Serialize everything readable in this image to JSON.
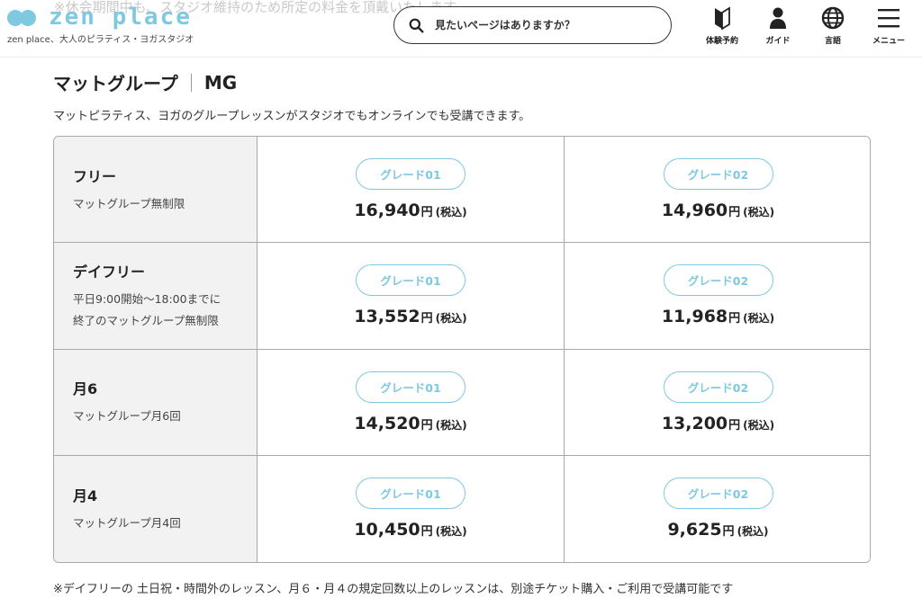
{
  "notice": "※休会期間中も、スタジオ維持のため所定の料金を頂戴いたします",
  "brand": {
    "logo_text": "zen place",
    "tagline": "zen place、大人のピラティス・ヨガスタジオ",
    "accent_color": "#7ec8e0"
  },
  "search": {
    "placeholder": "見たいページはありますか？",
    "icon": "search-icon"
  },
  "nav": {
    "trial": {
      "label": "体験予約",
      "icon": "beginner-mark-icon"
    },
    "guide": {
      "label": "ガイド",
      "icon": "person-icon"
    },
    "language": {
      "label": "言語",
      "icon": "globe-icon"
    },
    "menu": {
      "label": "メニュー",
      "icon": "hamburger-icon"
    }
  },
  "section": {
    "title": "マットグループ",
    "code": "MG",
    "lead": "マットピラティス、ヨガのグループレッスンがスタジオでもオンラインでも受講できます。"
  },
  "grades": [
    "グレード01",
    "グレード02"
  ],
  "currency": "円",
  "tax_label": "(税込)",
  "plans": [
    {
      "name": "フリー",
      "desc1": "マットグループ無制限",
      "desc2": "",
      "price_g1": "16,940",
      "price_g2": "14,960"
    },
    {
      "name": "デイフリー",
      "desc1": "平日9:00開始〜18:00までに",
      "desc2": "終了のマットグループ無制限",
      "price_g1": "13,552",
      "price_g2": "11,968"
    },
    {
      "name": "月6",
      "desc1": "マットグループ月6回",
      "desc2": "",
      "price_g1": "14,520",
      "price_g2": "13,200"
    },
    {
      "name": "月4",
      "desc1": "マットグループ月4回",
      "desc2": "",
      "price_g1": "10,450",
      "price_g2": "9,625"
    }
  ],
  "footnote": "※デイフリーの 土日祝・時間外のレッスン、月６・月４の規定回数以上のレッスンは、別途チケット購入・ご利用で受講可能です"
}
